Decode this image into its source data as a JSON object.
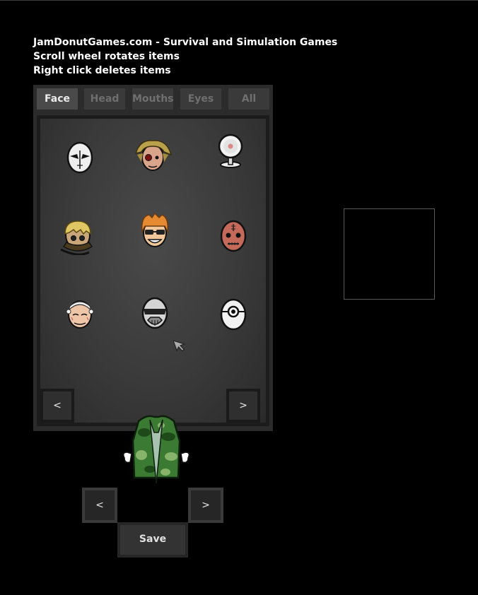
{
  "info": {
    "line1": "JamDonutGames.com - Survival and Simulation Games",
    "line2": "Scroll wheel rotates items",
    "line3": "Right click deletes items"
  },
  "tabs": [
    {
      "label": "Face",
      "active": true
    },
    {
      "label": "Head",
      "active": false
    },
    {
      "label": "Mouths",
      "active": false
    },
    {
      "label": "Eyes",
      "active": false
    },
    {
      "label": "All",
      "active": false
    }
  ],
  "grid_items": [
    {
      "icon": "white-alien-mask-icon"
    },
    {
      "icon": "blonde-scarred-face-icon"
    },
    {
      "icon": "round-mirror-icon"
    },
    {
      "icon": "blonde-bandana-face-icon"
    },
    {
      "icon": "orange-hair-sunglasses-face-icon"
    },
    {
      "icon": "stitched-red-face-icon"
    },
    {
      "icon": "bandaged-bald-face-icon"
    },
    {
      "icon": "gas-mask-icon"
    },
    {
      "icon": "cyclops-mask-icon"
    }
  ],
  "grid_nav": {
    "prev": "<",
    "next": ">"
  },
  "bottom_nav": {
    "prev": "<",
    "next": ">"
  },
  "save_label": "Save",
  "colors": {
    "background": "#000000",
    "panel": "#2b2b2b",
    "tab_active": "#4a4a4a",
    "tab_inactive": "#3a3a3a",
    "camo_green": "#2f6a2a"
  }
}
